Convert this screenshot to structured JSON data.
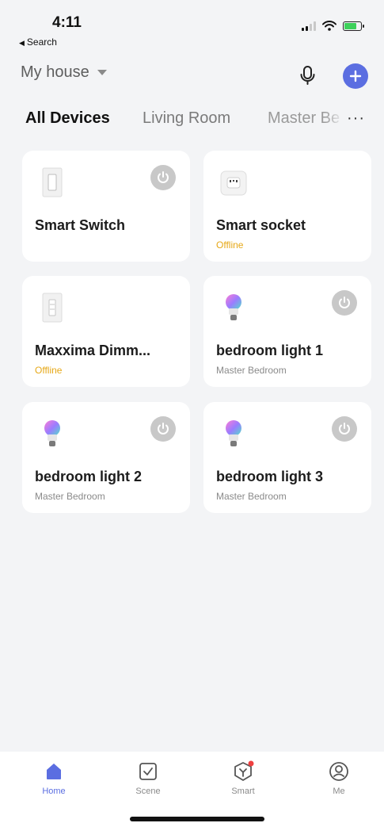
{
  "status_bar": {
    "time": "4:11",
    "back_label": "Search"
  },
  "header": {
    "home_name": "My house"
  },
  "tabs": [
    {
      "label": "All Devices",
      "active": true
    },
    {
      "label": "Living Room",
      "active": false
    },
    {
      "label": "Master Be",
      "active": false
    }
  ],
  "more_label": "···",
  "devices": [
    {
      "name": "Smart Switch",
      "subtitle": "",
      "icon": "switch-icon",
      "has_power": true
    },
    {
      "name": "Smart socket",
      "subtitle": "Offline",
      "icon": "socket-icon",
      "has_power": false
    },
    {
      "name": "Maxxima Dimm...",
      "subtitle": "Offline",
      "icon": "dimmer-icon",
      "has_power": false
    },
    {
      "name": "bedroom light 1",
      "subtitle": "Master Bedroom",
      "icon": "bulb-icon",
      "has_power": true
    },
    {
      "name": "bedroom light 2",
      "subtitle": "Master Bedroom",
      "icon": "bulb-icon",
      "has_power": true
    },
    {
      "name": "bedroom light 3",
      "subtitle": "Master Bedroom",
      "icon": "bulb-icon",
      "has_power": true
    }
  ],
  "nav": [
    {
      "label": "Home",
      "icon": "home-icon",
      "active": true
    },
    {
      "label": "Scene",
      "icon": "scene-icon",
      "active": false
    },
    {
      "label": "Smart",
      "icon": "smart-icon",
      "active": false
    },
    {
      "label": "Me",
      "icon": "profile-icon",
      "active": false
    }
  ],
  "colors": {
    "accent": "#5b6ee1",
    "offline": "#e6a817",
    "power_off": "#c8c8c8",
    "background": "#f3f4f6"
  }
}
